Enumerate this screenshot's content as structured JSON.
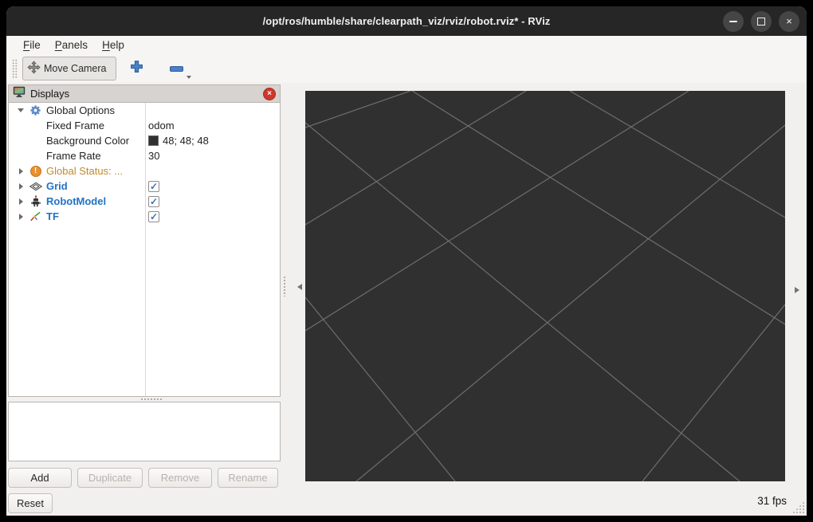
{
  "window": {
    "title": "/opt/ros/humble/share/clearpath_viz/rviz/robot.rviz* - RViz",
    "close_glyph": "×"
  },
  "menubar": {
    "items": [
      {
        "mnemonic": "F",
        "rest": "ile"
      },
      {
        "mnemonic": "P",
        "rest": "anels"
      },
      {
        "mnemonic": "H",
        "rest": "elp"
      }
    ]
  },
  "toolbar": {
    "move_camera_label": "Move Camera"
  },
  "displays": {
    "title": "Displays",
    "close_glyph": "×",
    "rows": {
      "global_options": {
        "label": "Global Options"
      },
      "fixed_frame": {
        "label": "Fixed Frame",
        "value": "odom"
      },
      "background_color": {
        "label": "Background Color",
        "value": "48; 48; 48",
        "swatch": "#303030"
      },
      "frame_rate": {
        "label": "Frame Rate",
        "value": "30"
      },
      "global_status": {
        "label": "Global Status: ...",
        "warning_glyph": "!"
      },
      "grid": {
        "label": "Grid",
        "checked": true
      },
      "robot_model": {
        "label": "RobotModel",
        "checked": true
      },
      "tf": {
        "label": "TF",
        "checked": true
      }
    },
    "buttons": {
      "add": "Add",
      "duplicate": "Duplicate",
      "remove": "Remove",
      "rename": "Rename"
    }
  },
  "viewport": {
    "background": "#303030",
    "grid_line_color": "#6e6e6e"
  },
  "statusbar": {
    "reset_label": "Reset",
    "fps": "31 fps"
  },
  "glyphs": {
    "check": "✓"
  }
}
